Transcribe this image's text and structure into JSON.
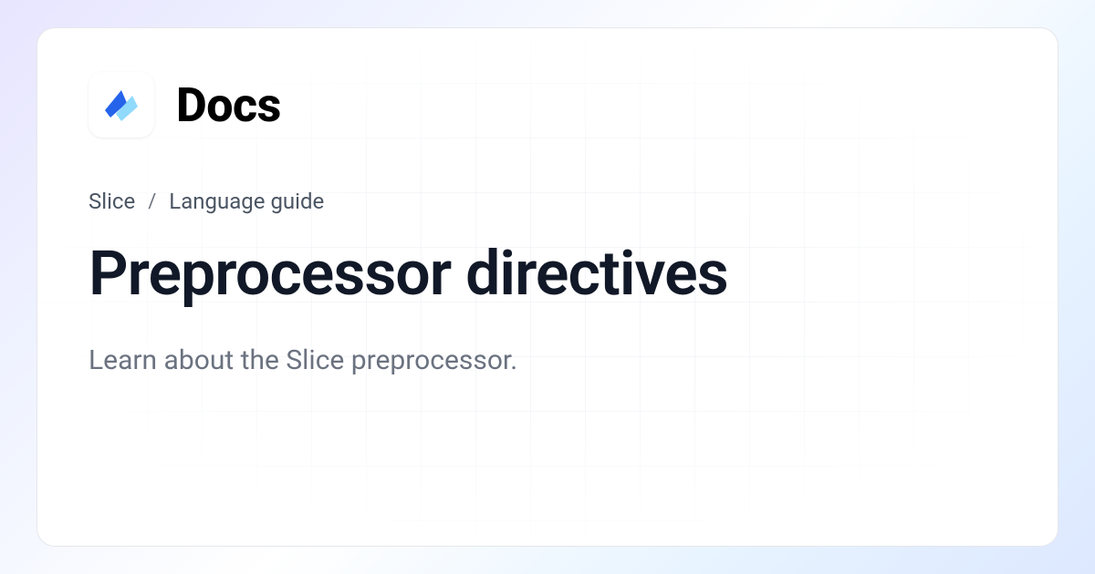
{
  "header": {
    "title": "Docs"
  },
  "breadcrumb": {
    "items": [
      "Slice",
      "Language guide"
    ],
    "separator": "/"
  },
  "page": {
    "title": "Preprocessor directives",
    "description": "Learn about the Slice preprocessor."
  }
}
